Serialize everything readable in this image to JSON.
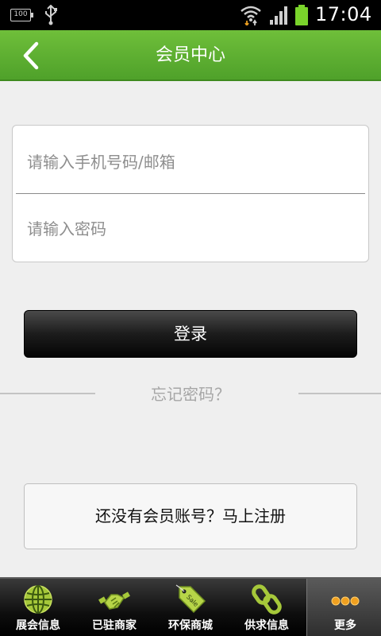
{
  "status_bar": {
    "battery_small": "100",
    "time": "17:04"
  },
  "header": {
    "title": "会员中心"
  },
  "form": {
    "username_placeholder": "请输入手机号码/邮箱",
    "password_placeholder": "请输入密码",
    "login_label": "登录",
    "forgot_label": "忘记密码？",
    "register_label": "还没有会员账号？马上注册"
  },
  "colors": {
    "header_green": "#5aad2f",
    "nav_background": "#111111",
    "battery_green": "#7ad42b"
  },
  "bottom_nav": {
    "items": [
      {
        "label": "展会信息",
        "icon": "globe-icon"
      },
      {
        "label": "已驻商家",
        "icon": "handshake-icon"
      },
      {
        "label": "环保商城",
        "icon": "sale-tag-icon"
      },
      {
        "label": "供求信息",
        "icon": "chain-link-icon"
      },
      {
        "label": "更多",
        "icon": "more-dots-icon",
        "active": true
      }
    ]
  }
}
